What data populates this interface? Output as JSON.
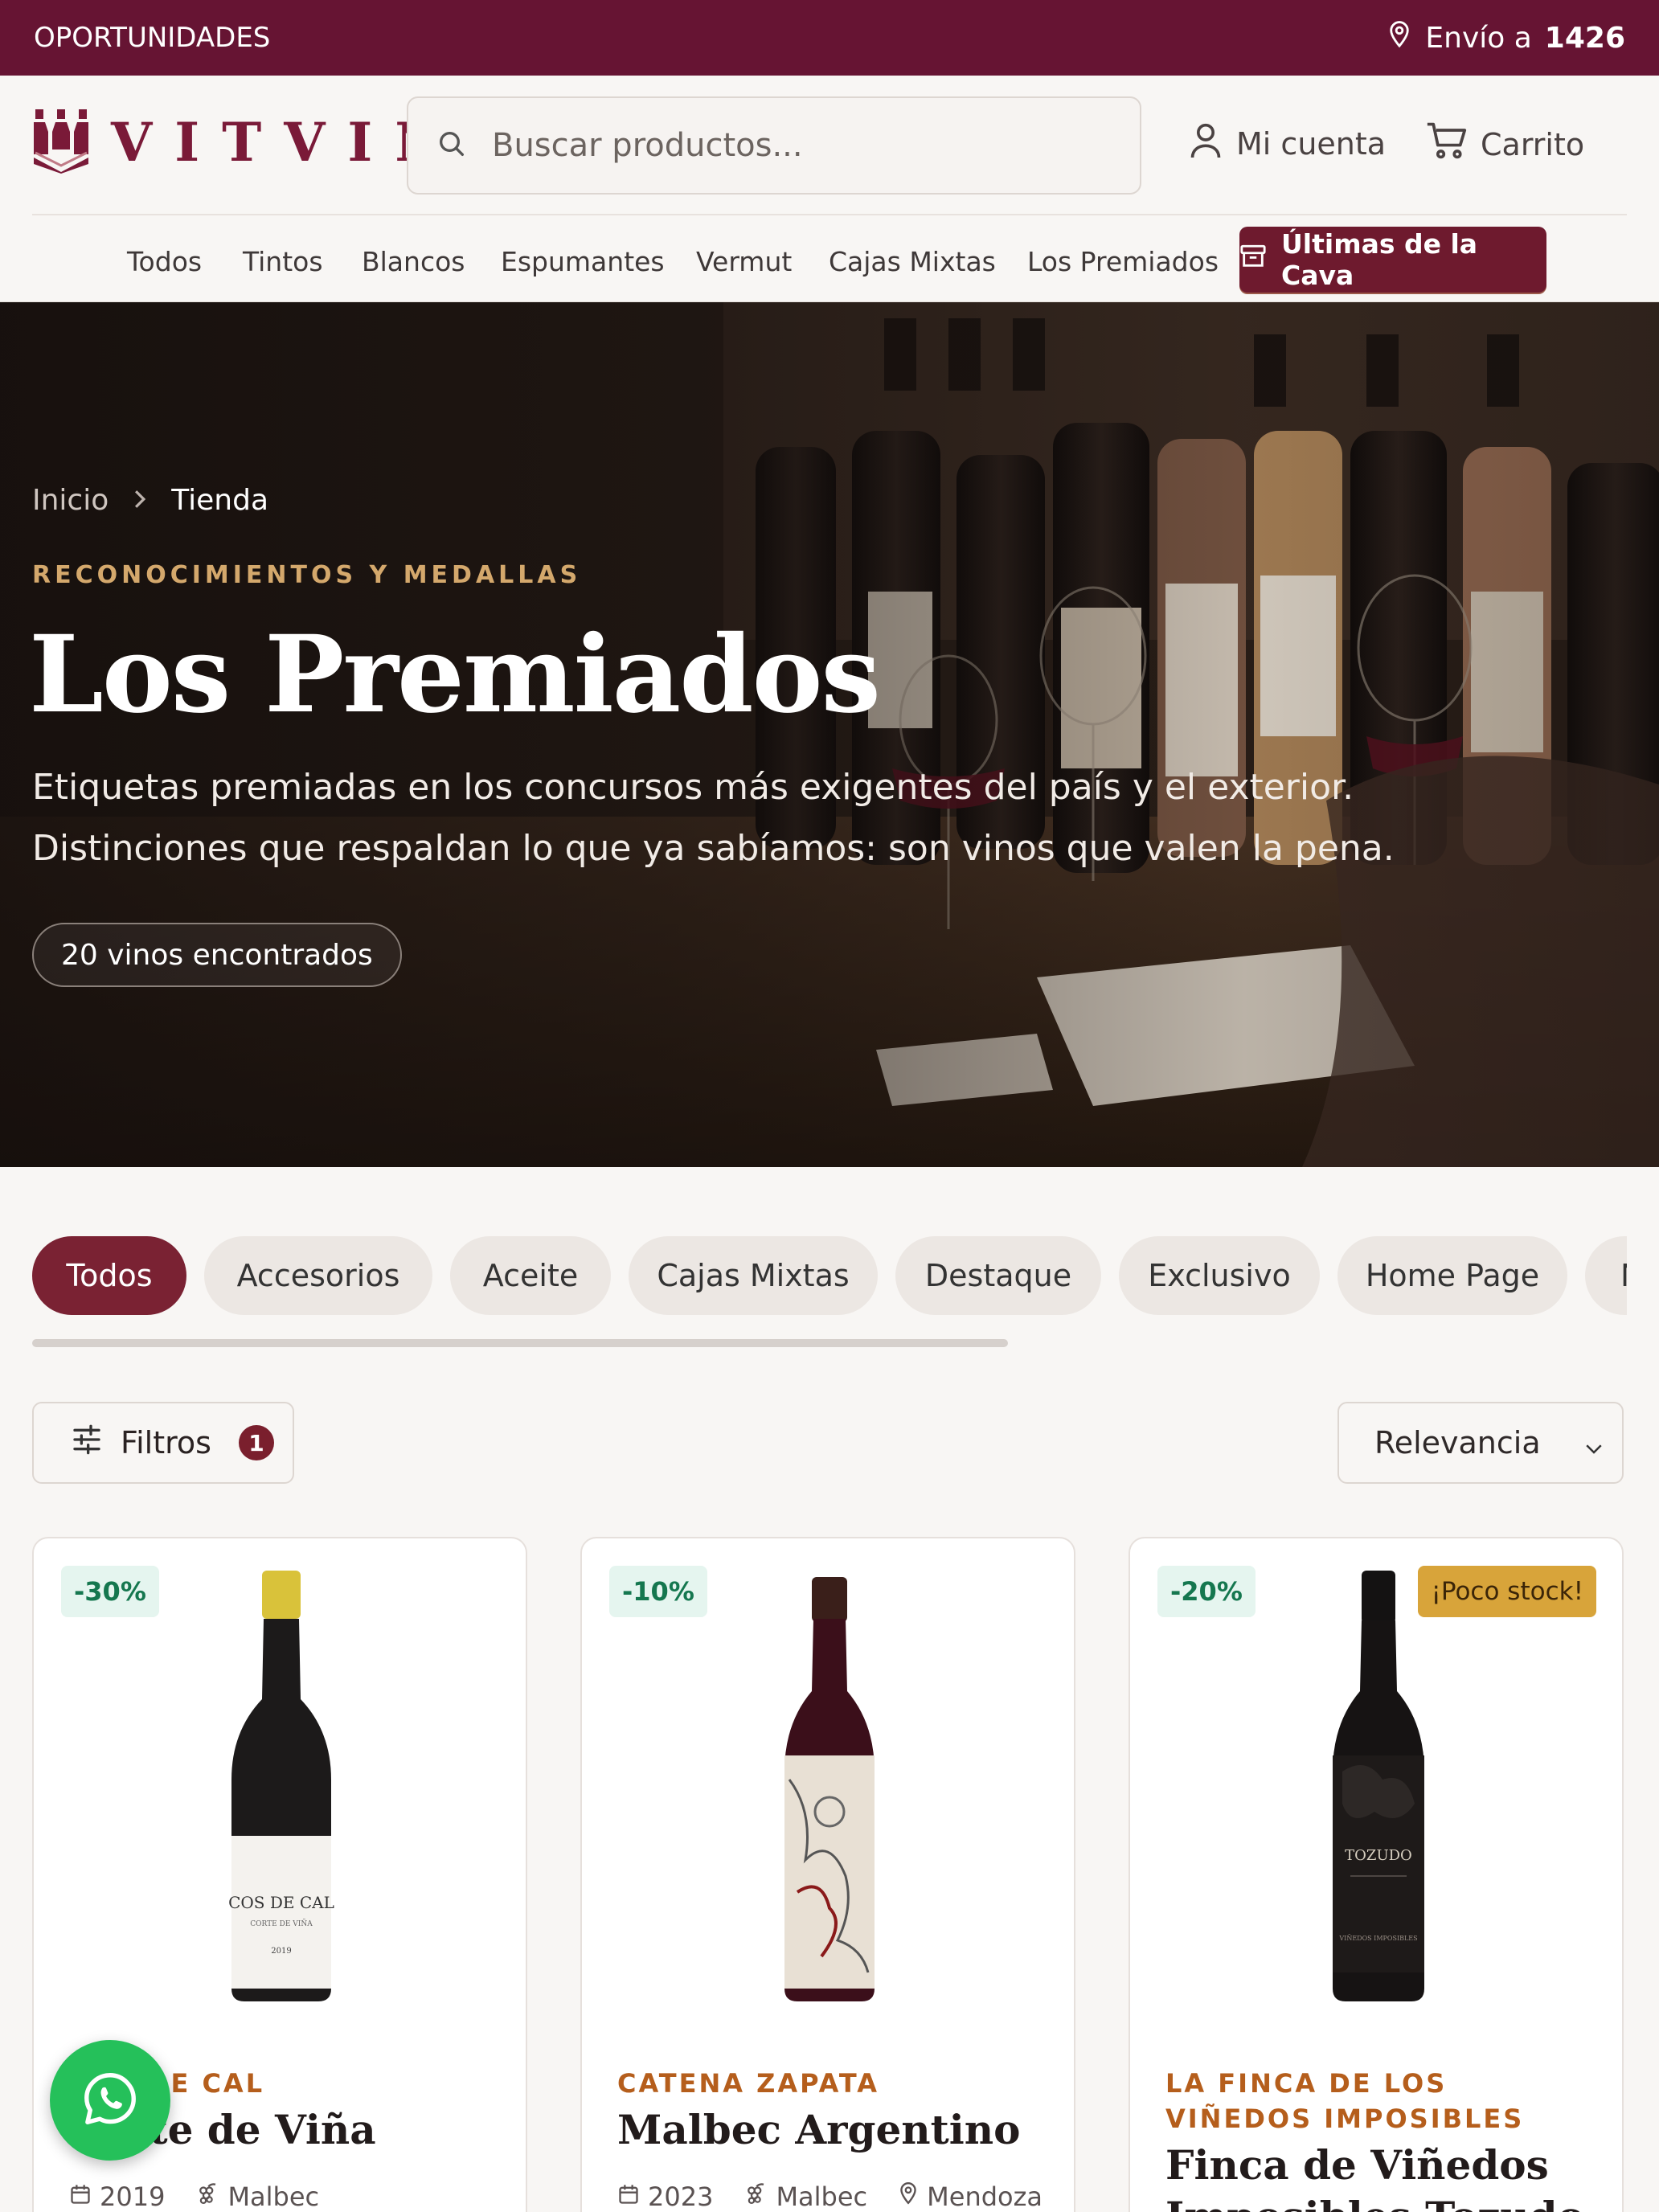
{
  "topbar": {
    "promo": "OPORTUNIDADES",
    "ship_label": "Envío a",
    "ship_code": "1426"
  },
  "header": {
    "logo_text": "VITVIN",
    "search_placeholder": "Buscar productos...",
    "account_label": "Mi cuenta",
    "cart_label": "Carrito"
  },
  "nav": {
    "items": [
      "Todos",
      "Tintos",
      "Blancos",
      "Espumantes",
      "Vermut",
      "Cajas Mixtas",
      "Los Premiados"
    ],
    "special_label": "Últimas de la Cava"
  },
  "hero": {
    "breadcrumb": [
      "Inicio",
      "Tienda"
    ],
    "eyebrow": "RECONOCIMIENTOS Y MEDALLAS",
    "title": "Los Premiados",
    "lead_1": "Etiquetas premiadas en los concursos más exigentes del país y el exterior.",
    "lead_2": "Distinciones que respaldan lo que ya sabíamos: son vinos que valen la pena.",
    "count": "20 vinos encontrados"
  },
  "chips": [
    "Todos",
    "Accesorios",
    "Aceite",
    "Cajas Mixtas",
    "Destaque",
    "Exclusivo",
    "Home Page",
    "N"
  ],
  "toolbar": {
    "filters_label": "Filtros",
    "filters_count": "1",
    "sort_value": "Relevancia"
  },
  "products": [
    {
      "discount": "-30%",
      "winery": "COS DE CAL",
      "name": "Corte de Viña",
      "year": "2019",
      "grape": "Malbec",
      "region": "",
      "stock": ""
    },
    {
      "discount": "-10%",
      "winery": "CATENA ZAPATA",
      "name": "Malbec Argentino",
      "year": "2023",
      "grape": "Malbec",
      "region": "Mendoza",
      "stock": ""
    },
    {
      "discount": "-20%",
      "winery": "LA FINCA DE LOS VIÑEDOS IMPOSIBLES",
      "name": "Finca de Viñedos Imposibles Tozudo",
      "year": "",
      "grape": "",
      "region": "",
      "stock": "¡Poco stock!"
    }
  ],
  "colors": {
    "brand": "#661433",
    "accent_gold": "#d4a86c",
    "winery": "#b55e1c",
    "whatsapp": "#25c05a"
  },
  "icons": [
    "location-pin-icon",
    "search-icon",
    "user-icon",
    "cart-icon",
    "archive-icon",
    "chevron-right-icon",
    "sliders-icon",
    "chevron-down-icon",
    "calendar-icon",
    "grape-icon",
    "whatsapp-icon"
  ]
}
